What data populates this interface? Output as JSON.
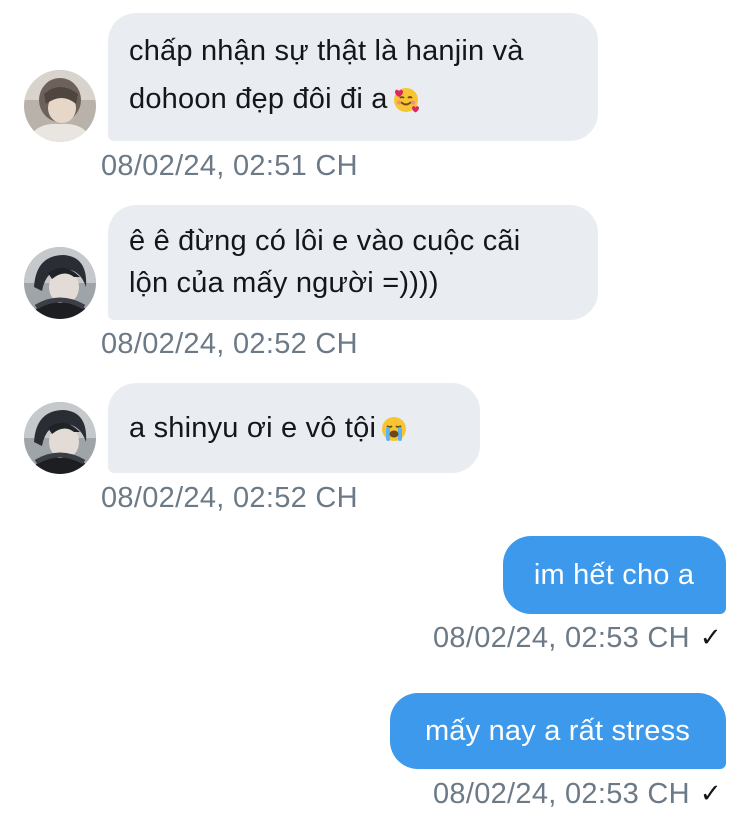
{
  "conversation": {
    "messages": [
      {
        "direction": "incoming",
        "lines": [
          "chấp nhận sự thật là hanjin và",
          "dohoon đẹp đôi đi a"
        ],
        "emoji": "smiling-face-with-hearts",
        "timestamp": "08/02/24, 02:51 CH"
      },
      {
        "direction": "incoming",
        "lines": [
          "ê ê đừng có lôi e vào cuộc cãi",
          "lộn của mấy người =))))"
        ],
        "timestamp": "08/02/24, 02:52 CH"
      },
      {
        "direction": "incoming",
        "lines": [
          "a shinyu ơi e vô tội"
        ],
        "emoji": "loudly-crying-face",
        "timestamp": "08/02/24, 02:52 CH"
      },
      {
        "direction": "outgoing",
        "lines": [
          "im hết cho a"
        ],
        "timestamp": "08/02/24, 02:53 CH",
        "status_icon": "checkmark"
      },
      {
        "direction": "outgoing",
        "lines": [
          "mấy nay a rất stress"
        ],
        "timestamp": "08/02/24, 02:53 CH",
        "status_icon": "checkmark"
      }
    ]
  },
  "colors": {
    "incoming_bubble": "#e9ecf0",
    "outgoing_bubble": "#3d99eb",
    "timestamp_text": "#6c7a87"
  }
}
